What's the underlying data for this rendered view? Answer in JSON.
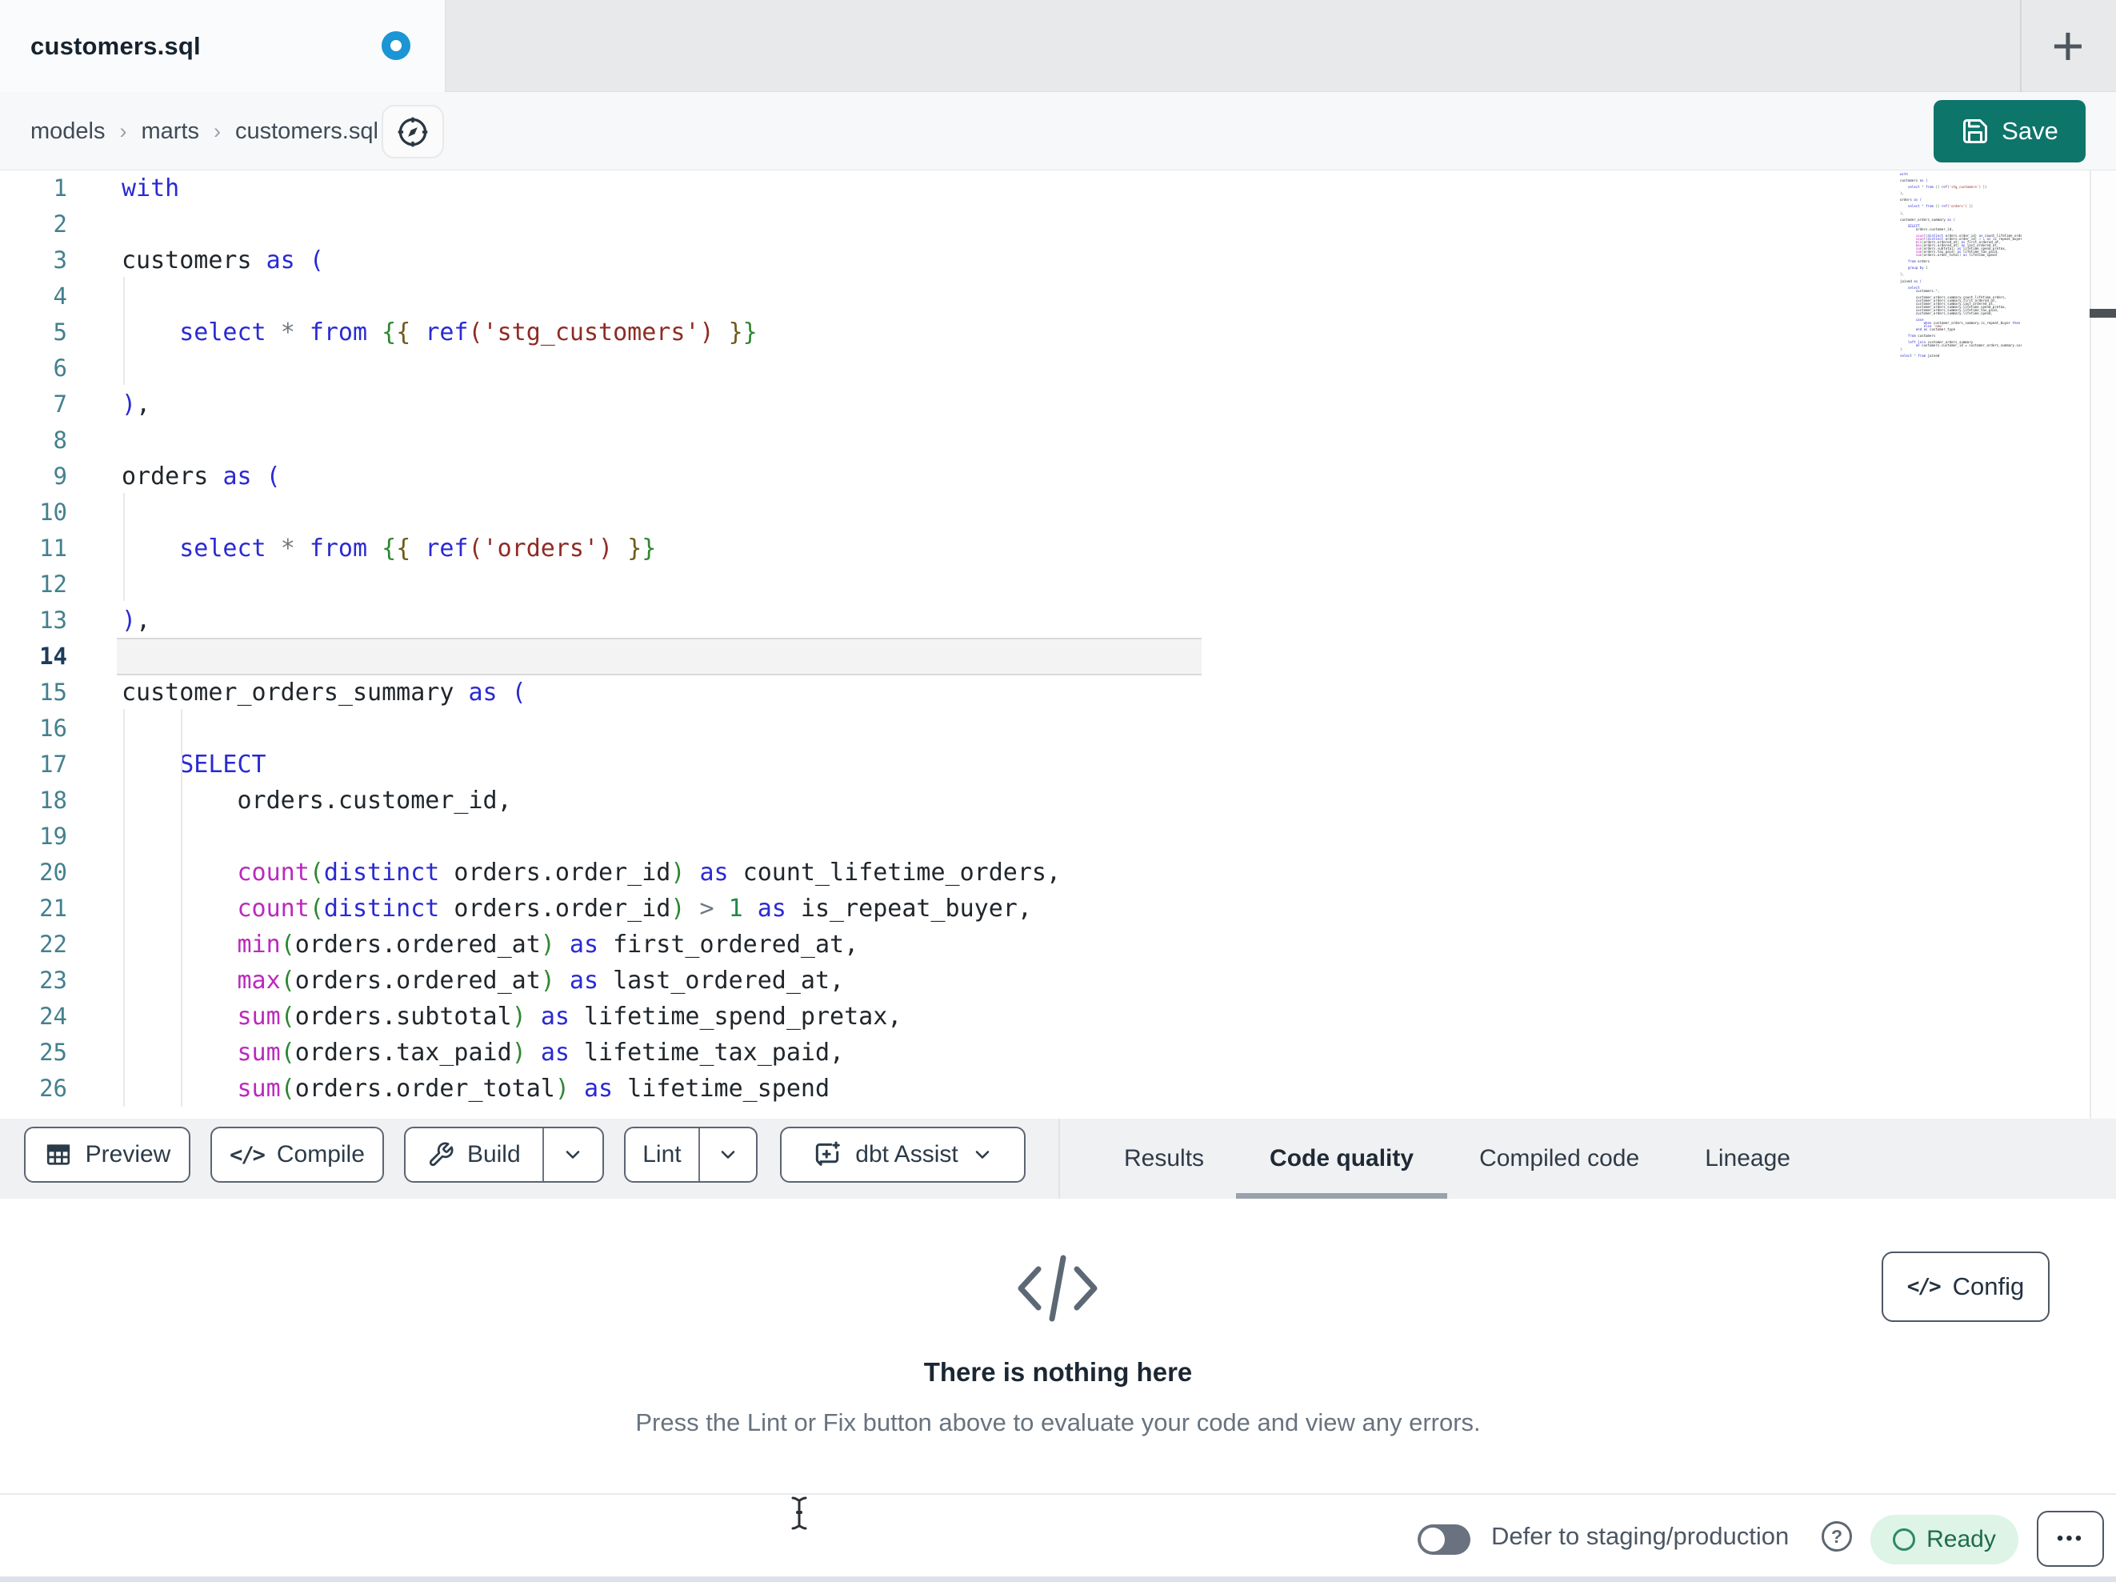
{
  "colors": {
    "accent_teal": "#0e756b",
    "modified_dot": "#1b95d3",
    "kw": "#2a2ad2",
    "fn": "#bb2abd",
    "str": "#8f2b24",
    "jinja_green": "#2f8732",
    "jinja_olive": "#6f5a1c",
    "number_green": "#1f8a49",
    "operator_gray": "#6e7781",
    "code_text": "#20262b",
    "gutter_num": "#44808f",
    "gutter_num_active": "#1d3b5e",
    "tab_underline": "#9aa2ab",
    "ready_bg": "#ddf4e7",
    "ready_text": "#206b4b",
    "ready_ring": "#2d8a5d"
  },
  "tab_bar": {
    "active_tab_label": "customers.sql",
    "new_tab_label": "+"
  },
  "breadcrumb": {
    "items": [
      "models",
      "marts",
      "customers.sql"
    ],
    "separator": "›"
  },
  "header": {
    "save_label": "Save"
  },
  "editor": {
    "active_line": 14,
    "lines": [
      [
        [
          "kw",
          "with"
        ]
      ],
      [],
      [
        [
          "txt",
          "customers "
        ],
        [
          "kw",
          "as"
        ],
        [
          "txt",
          " "
        ],
        [
          "kw",
          "("
        ]
      ],
      [],
      [
        [
          "txt",
          "    "
        ],
        [
          "kw",
          "select"
        ],
        [
          "txt",
          " "
        ],
        [
          "op",
          "*"
        ],
        [
          "txt",
          " "
        ],
        [
          "kw",
          "from"
        ],
        [
          "txt",
          " "
        ],
        [
          "jb",
          "{"
        ],
        [
          "jo",
          "{"
        ],
        [
          "txt",
          " "
        ],
        [
          "kw",
          "ref"
        ],
        [
          "str",
          "('stg_customers')"
        ],
        [
          "txt",
          " "
        ],
        [
          "jo",
          "}"
        ],
        [
          "jb",
          "}"
        ]
      ],
      [],
      [
        [
          "kw",
          ")"
        ],
        [
          "txt",
          ","
        ]
      ],
      [],
      [
        [
          "txt",
          "orders "
        ],
        [
          "kw",
          "as"
        ],
        [
          "txt",
          " "
        ],
        [
          "kw",
          "("
        ]
      ],
      [],
      [
        [
          "txt",
          "    "
        ],
        [
          "kw",
          "select"
        ],
        [
          "txt",
          " "
        ],
        [
          "op",
          "*"
        ],
        [
          "txt",
          " "
        ],
        [
          "kw",
          "from"
        ],
        [
          "txt",
          " "
        ],
        [
          "jb",
          "{"
        ],
        [
          "jo",
          "{"
        ],
        [
          "txt",
          " "
        ],
        [
          "kw",
          "ref"
        ],
        [
          "str",
          "('orders')"
        ],
        [
          "txt",
          " "
        ],
        [
          "jo",
          "}"
        ],
        [
          "jb",
          "}"
        ]
      ],
      [],
      [
        [
          "kw",
          ")"
        ],
        [
          "txt",
          ","
        ]
      ],
      [],
      [
        [
          "txt",
          "customer_orders_summary "
        ],
        [
          "kw",
          "as"
        ],
        [
          "txt",
          " "
        ],
        [
          "kw",
          "("
        ]
      ],
      [],
      [
        [
          "txt",
          "    "
        ],
        [
          "kw",
          "SELECT"
        ]
      ],
      [
        [
          "txt",
          "        orders.customer_id,"
        ]
      ],
      [],
      [
        [
          "txt",
          "        "
        ],
        [
          "fn",
          "count"
        ],
        [
          "jb",
          "("
        ],
        [
          "kw",
          "distinct"
        ],
        [
          "txt",
          " orders.order_id"
        ],
        [
          "jb",
          ")"
        ],
        [
          "txt",
          " "
        ],
        [
          "kw",
          "as"
        ],
        [
          "txt",
          " count_lifetime_orders,"
        ]
      ],
      [
        [
          "txt",
          "        "
        ],
        [
          "fn",
          "count"
        ],
        [
          "jb",
          "("
        ],
        [
          "kw",
          "distinct"
        ],
        [
          "txt",
          " orders.order_id"
        ],
        [
          "jb",
          ")"
        ],
        [
          "txt",
          " "
        ],
        [
          "op",
          ">"
        ],
        [
          "txt",
          " "
        ],
        [
          "num",
          "1"
        ],
        [
          "txt",
          " "
        ],
        [
          "kw",
          "as"
        ],
        [
          "txt",
          " is_repeat_buyer,"
        ]
      ],
      [
        [
          "txt",
          "        "
        ],
        [
          "fn",
          "min"
        ],
        [
          "jb",
          "("
        ],
        [
          "txt",
          "orders.ordered_at"
        ],
        [
          "jb",
          ")"
        ],
        [
          "txt",
          " "
        ],
        [
          "kw",
          "as"
        ],
        [
          "txt",
          " first_ordered_at,"
        ]
      ],
      [
        [
          "txt",
          "        "
        ],
        [
          "fn",
          "max"
        ],
        [
          "jb",
          "("
        ],
        [
          "txt",
          "orders.ordered_at"
        ],
        [
          "jb",
          ")"
        ],
        [
          "txt",
          " "
        ],
        [
          "kw",
          "as"
        ],
        [
          "txt",
          " last_ordered_at,"
        ]
      ],
      [
        [
          "txt",
          "        "
        ],
        [
          "fn",
          "sum"
        ],
        [
          "jb",
          "("
        ],
        [
          "txt",
          "orders.subtotal"
        ],
        [
          "jb",
          ")"
        ],
        [
          "txt",
          " "
        ],
        [
          "kw",
          "as"
        ],
        [
          "txt",
          " lifetime_spend_pretax,"
        ]
      ],
      [
        [
          "txt",
          "        "
        ],
        [
          "fn",
          "sum"
        ],
        [
          "jb",
          "("
        ],
        [
          "txt",
          "orders.tax_paid"
        ],
        [
          "jb",
          ")"
        ],
        [
          "txt",
          " "
        ],
        [
          "kw",
          "as"
        ],
        [
          "txt",
          " lifetime_tax_paid,"
        ]
      ],
      [
        [
          "txt",
          "        "
        ],
        [
          "fn",
          "sum"
        ],
        [
          "jb",
          "("
        ],
        [
          "txt",
          "orders.order_total"
        ],
        [
          "jb",
          ")"
        ],
        [
          "txt",
          " "
        ],
        [
          "kw",
          "as"
        ],
        [
          "txt",
          " lifetime_spend"
        ]
      ]
    ],
    "minimap_extra_lines": [
      [],
      [
        [
          "txt",
          "    "
        ],
        [
          "kw",
          "from"
        ],
        [
          "txt",
          " orders"
        ]
      ],
      [],
      [
        [
          "txt",
          "    "
        ],
        [
          "kw",
          "group by"
        ],
        [
          "txt",
          " "
        ],
        [
          "num",
          "1"
        ]
      ],
      [],
      [
        [
          "kw",
          ")"
        ],
        [
          "txt",
          ","
        ]
      ],
      [],
      [
        [
          "txt",
          "joined "
        ],
        [
          "kw",
          "as"
        ],
        [
          "txt",
          " "
        ],
        [
          "kw",
          "("
        ]
      ],
      [],
      [
        [
          "txt",
          "    "
        ],
        [
          "kw",
          "select"
        ]
      ],
      [
        [
          "txt",
          "        customers."
        ],
        [
          "op",
          "*"
        ],
        [
          "txt",
          ","
        ]
      ],
      [],
      [
        [
          "txt",
          "        customer_orders_summary.count_lifetime_orders,"
        ]
      ],
      [
        [
          "txt",
          "        customer_orders_summary.first_ordered_at,"
        ]
      ],
      [
        [
          "txt",
          "        customer_orders_summary.last_ordered_at,"
        ]
      ],
      [
        [
          "txt",
          "        customer_orders_summary.lifetime_spend_pretax,"
        ]
      ],
      [
        [
          "txt",
          "        customer_orders_summary.lifetime_tax_paid,"
        ]
      ],
      [
        [
          "txt",
          "        customer_orders_summary.lifetime_spend,"
        ]
      ],
      [],
      [
        [
          "txt",
          "        "
        ],
        [
          "kw",
          "case"
        ]
      ],
      [
        [
          "txt",
          "            "
        ],
        [
          "kw",
          "when"
        ],
        [
          "txt",
          " customer_orders_summary.is_repeat_buyer "
        ],
        [
          "kw",
          "then"
        ],
        [
          "txt",
          " "
        ],
        [
          "str",
          "'returning'"
        ]
      ],
      [
        [
          "txt",
          "            "
        ],
        [
          "kw",
          "else"
        ],
        [
          "txt",
          " "
        ],
        [
          "str",
          "'new'"
        ]
      ],
      [
        [
          "txt",
          "        "
        ],
        [
          "kw",
          "end"
        ],
        [
          "txt",
          " "
        ],
        [
          "kw",
          "as"
        ],
        [
          "txt",
          " customer_type"
        ]
      ],
      [],
      [
        [
          "txt",
          "    "
        ],
        [
          "kw",
          "from"
        ],
        [
          "txt",
          " customers"
        ]
      ],
      [],
      [
        [
          "txt",
          "    "
        ],
        [
          "kw",
          "left join"
        ],
        [
          "txt",
          " customer_orders_summary"
        ]
      ],
      [
        [
          "txt",
          "        "
        ],
        [
          "kw",
          "on"
        ],
        [
          "txt",
          " customers.customer_id = customer_orders_summary.customer_id"
        ]
      ],
      [
        [
          "kw",
          ")"
        ]
      ],
      [],
      [
        [
          "kw",
          "select"
        ],
        [
          "txt",
          " "
        ],
        [
          "op",
          "*"
        ],
        [
          "txt",
          " "
        ],
        [
          "kw",
          "from"
        ],
        [
          "txt",
          " joined"
        ]
      ]
    ]
  },
  "toolbar": {
    "preview_label": "Preview",
    "compile_label": "Compile",
    "compile_icon": "</>",
    "build_label": "Build",
    "lint_label": "Lint",
    "assist_label": "dbt Assist"
  },
  "result_tabs": [
    {
      "label": "Results",
      "active": false
    },
    {
      "label": "Code quality",
      "active": true
    },
    {
      "label": "Compiled code",
      "active": false
    },
    {
      "label": "Lineage",
      "active": false
    }
  ],
  "panel": {
    "config_label": "Config",
    "config_icon": "</>",
    "empty_title": "There is nothing here",
    "empty_subtitle": "Press the Lint or Fix button above to evaluate your code and view any errors."
  },
  "status_bar": {
    "defer_label": "Defer to staging/production",
    "defer_enabled": false,
    "help_label": "?",
    "ready_label": "Ready",
    "more_label": "•••"
  }
}
